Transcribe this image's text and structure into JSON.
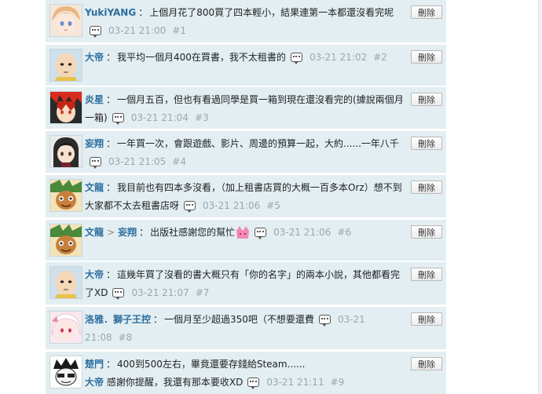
{
  "delete_label": "刪除",
  "comments": [
    {
      "user": "YukiYANG",
      "text": "上個月花了800買了四本輕小，結果連第一本都還沒看完呢",
      "time": "03-21 21:00",
      "floor": "#1"
    },
    {
      "user": "大帝",
      "text": "我平均一個月400在買書，我不太租書的",
      "time": "03-21 21:02",
      "floor": "#2"
    },
    {
      "user": "炎星",
      "text": "一個月五百，但也有看過同學是買一箱到現在還沒看完的(據說兩個月一箱)",
      "time": "03-21 21:04",
      "floor": "#3"
    },
    {
      "user": "妄翔",
      "text": "一年買一次，會跟遊戲、影片、周邊的預算一起，大約......一年八千",
      "time": "03-21 21:05",
      "floor": "#4"
    },
    {
      "user": "文龍",
      "text": "我目前也有四本多沒看，（加上租書店買的大概一百多本Orz）想不到大家都不太去租書店呀",
      "time": "03-21 21:06",
      "floor": "#5"
    },
    {
      "user": "文龍",
      "reply_to": "妄翔",
      "text": "出版社感謝您的幫忙",
      "time": "03-21 21:06",
      "floor": "#6"
    },
    {
      "user": "大帝",
      "text": "這幾年買了沒看的書大概只有「你的名字」的兩本小說，其他都看完了XD",
      "time": "03-21 21:07",
      "floor": "#7"
    },
    {
      "user": "洛雅．獅子王控",
      "text": "一個月至少超過350吧（不想要還費",
      "time": "03-21 21:08",
      "floor": "#8"
    },
    {
      "user": "楚門",
      "text": "400到500左右，畢竟還要存錢給Steam......",
      "reply_user": "大帝",
      "reply_text": "感謝你提醒，我還有那本要收XD",
      "time": "03-21 21:11",
      "floor": "#9"
    }
  ]
}
